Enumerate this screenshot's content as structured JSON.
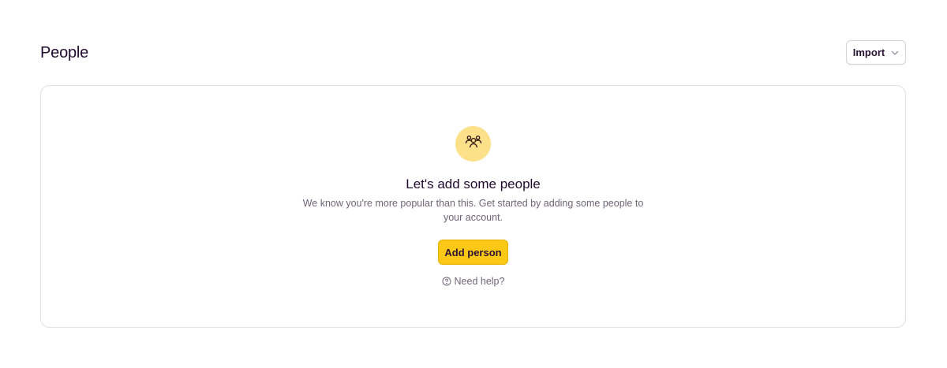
{
  "header": {
    "title": "People",
    "import_label": "Import",
    "import_icon": "chevron-down-icon"
  },
  "empty_state": {
    "icon": "people-group-icon",
    "title": "Let's add some people",
    "description": "We know you're more popular than this. Get started by adding some people to your account.",
    "add_label": "Add person",
    "help_label": "Need help?",
    "help_icon": "question-circle-icon"
  },
  "colors": {
    "accent": "#fbc915",
    "icon_bg": "#fde08a",
    "text": "#20062b",
    "muted": "#6f6477",
    "border": "#e3e0e5"
  }
}
